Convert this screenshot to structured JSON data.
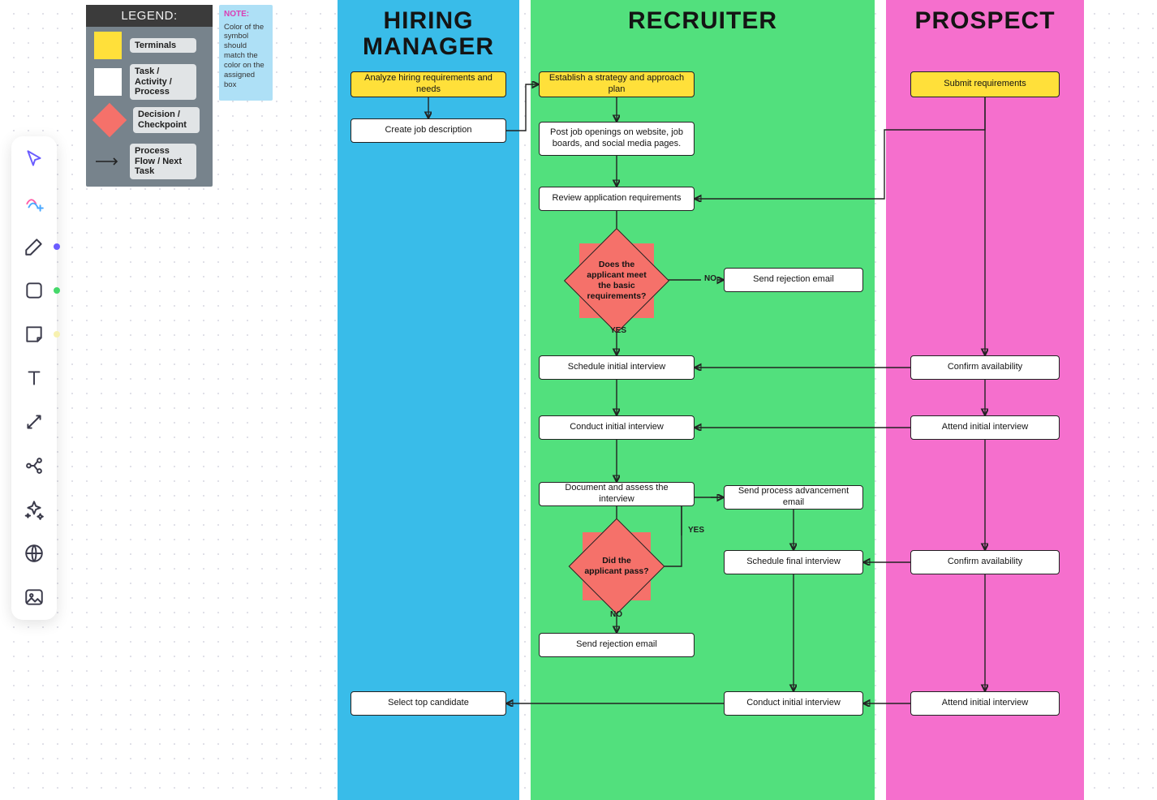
{
  "legend": {
    "title": "LEGEND:",
    "terminals": "Terminals",
    "task": "Task / Activity / Process",
    "decision": "Decision / Checkpoint",
    "flow": "Process Flow / Next Task"
  },
  "note": {
    "title": "NOTE:",
    "body": "Color of the symbol should match the color on the assigned box"
  },
  "lanes": {
    "hiring_manager": "HIRING MANAGER",
    "recruiter": "RECRUITER",
    "prospect": "PROSPECT"
  },
  "nodes": {
    "hm_analyze": "Analyze hiring requirements and needs",
    "hm_create_desc": "Create job description",
    "hm_select_top": "Select top candidate",
    "rc_strategy": "Establish a strategy and approach plan",
    "rc_post": "Post job openings on website, job boards, and social media pages.",
    "rc_review": "Review application requirements",
    "rc_dec1": "Does the applicant meet the basic requirements?",
    "rc_reject1": "Send rejection email",
    "rc_sched_init": "Schedule initial interview",
    "rc_conduct_init": "Conduct initial interview",
    "rc_doc_assess": "Document and assess the interview",
    "rc_dec2": "Did the applicant pass?",
    "rc_advance": "Send process advancement email",
    "rc_sched_final": "Schedule final interview",
    "rc_reject2": "Send rejection email",
    "rc_conduct_init2": "Conduct initial interview",
    "pr_submit": "Submit requirements",
    "pr_confirm1": "Confirm availability",
    "pr_attend1": "Attend initial interview",
    "pr_confirm2": "Confirm availability",
    "pr_attend2": "Attend initial interview"
  },
  "edge_labels": {
    "yes1": "YES",
    "no1": "NO",
    "yes2": "YES",
    "no2": "NO"
  },
  "tools": {
    "select": "select",
    "ai": "ai-assist",
    "pen": "pen",
    "shape": "shape",
    "sticky": "sticky-note",
    "text": "text",
    "connector": "connector",
    "mindmap": "mindmap",
    "sparkle": "magic",
    "globe": "embed",
    "image": "image"
  }
}
